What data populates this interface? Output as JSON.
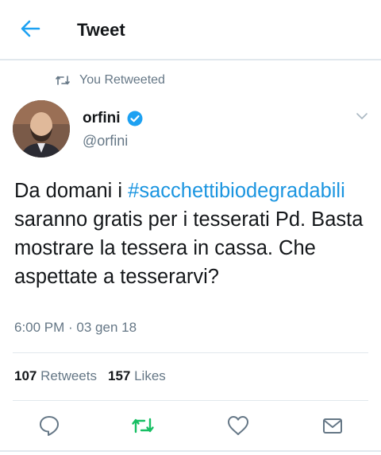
{
  "header": {
    "title": "Tweet"
  },
  "retweet_notice": "You Retweeted",
  "user": {
    "display_name": "orfini",
    "handle": "@orfini",
    "verified": true
  },
  "tweet": {
    "text_before": "Da domani i ",
    "hashtag": "#sacchettibiodegradabili",
    "text_after": " saranno gratis per i tesserati Pd. Basta mostrare la tessera in cassa. Che aspettate a tesserarvi?",
    "timestamp": "6:00 PM · 03 gen 18"
  },
  "stats": {
    "retweets_count": "107",
    "retweets_label": "Retweets",
    "likes_count": "157",
    "likes_label": "Likes"
  },
  "actions": [
    "reply-icon",
    "retweet-icon",
    "like-icon",
    "share-icon"
  ],
  "colors": {
    "accent": "#1da1f2",
    "retweet_active": "#17bf63",
    "secondary_text": "#657786",
    "divider": "#e1e8ed"
  }
}
